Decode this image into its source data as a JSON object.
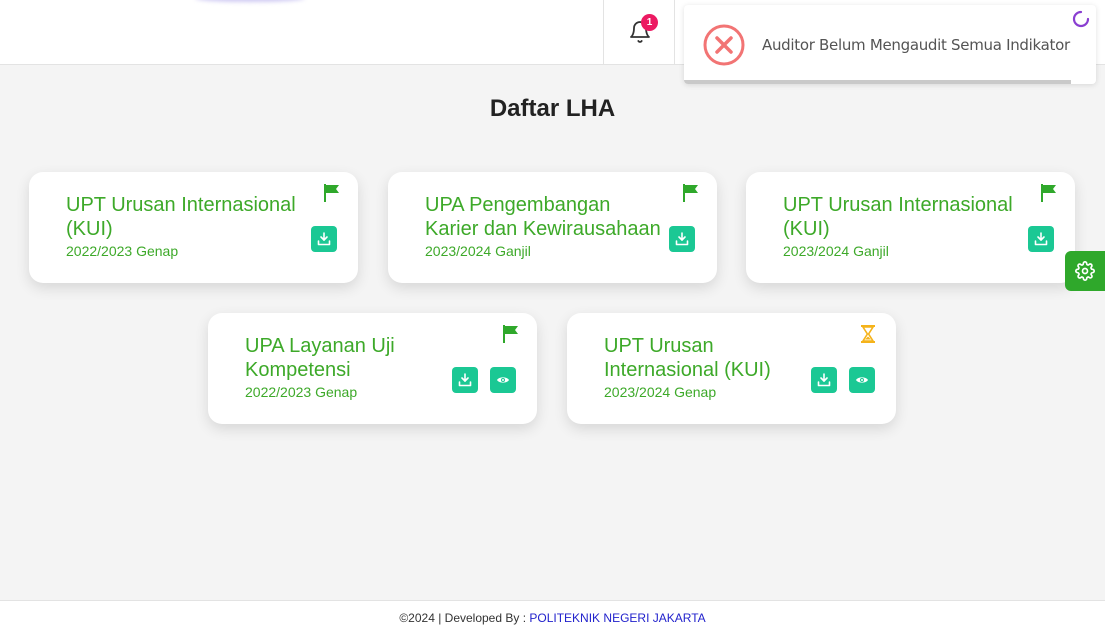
{
  "header": {
    "notification_count": "1"
  },
  "toast": {
    "message": "Auditor Belum Mengaudit Semua Indikator",
    "progress": 0.94,
    "colors": {
      "error": "#f27474",
      "spinner": "#8a3fd1"
    }
  },
  "page": {
    "title": "Daftar LHA"
  },
  "cards": [
    {
      "title": "UPT Urusan Internasional (KUI)",
      "period": "2022/2023 Genap",
      "status_icon": "flag-icon",
      "actions": [
        "download"
      ]
    },
    {
      "title": "UPA Pengembangan Karier dan Kewirausahaan",
      "period": "2023/2024 Ganjil",
      "status_icon": "flag-icon",
      "actions": [
        "download"
      ]
    },
    {
      "title": "UPT Urusan Internasional (KUI)",
      "period": "2023/2024 Ganjil",
      "status_icon": "flag-icon",
      "actions": [
        "download"
      ]
    },
    {
      "title": "UPA Layanan Uji Kompetensi",
      "period": "2022/2023 Genap",
      "status_icon": "flag-icon",
      "actions": [
        "download",
        "view"
      ]
    },
    {
      "title": "UPT Urusan Internasional (KUI)",
      "period": "2023/2024 Genap",
      "status_icon": "hourglass-icon",
      "actions": [
        "download",
        "view"
      ]
    }
  ],
  "footer": {
    "text": "©2024 | Developed By : ",
    "link": "POLITEKNIK NEGERI JAKARTA"
  },
  "colors": {
    "accent_green": "#3da929",
    "button_teal": "#1bc894",
    "flag_green": "#2fa82b",
    "hourglass": "#f5b31b",
    "badge": "#ec1a62",
    "link": "#2222cc"
  }
}
